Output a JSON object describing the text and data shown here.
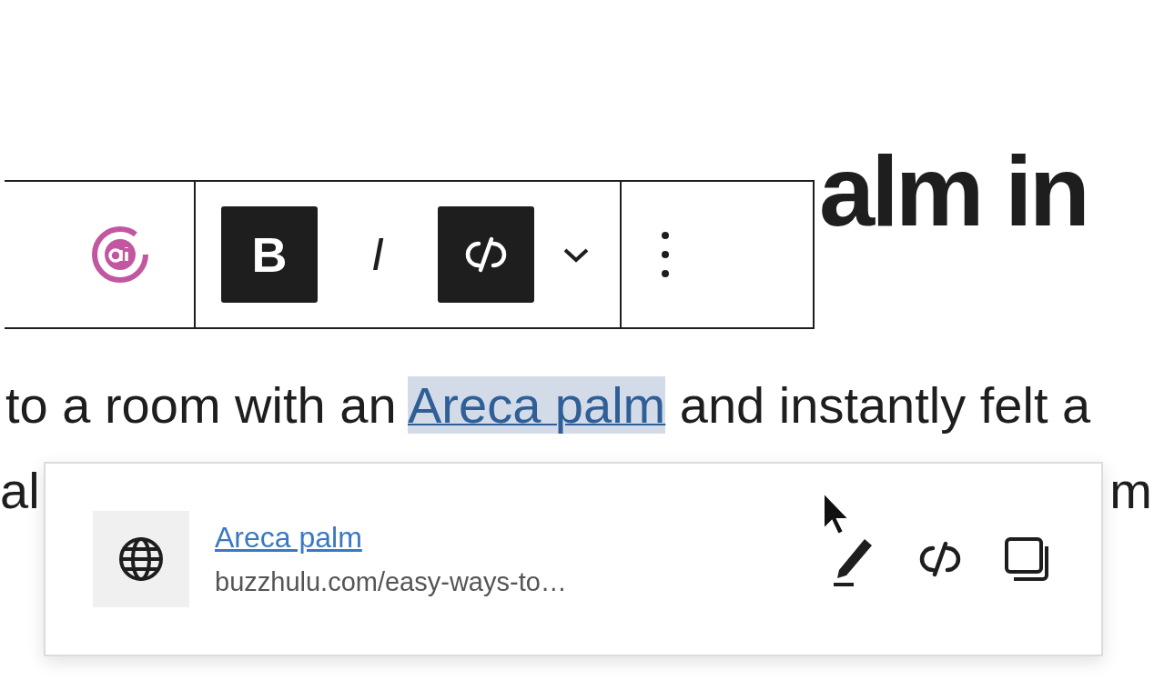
{
  "heading": "alm in",
  "toolbar": {
    "groups": [
      [
        {
          "kind": "ai",
          "selected": false
        }
      ],
      [
        {
          "kind": "bold",
          "label": "B",
          "selected": true
        },
        {
          "kind": "italic",
          "label": "I",
          "selected": false
        },
        {
          "kind": "link",
          "selected": true
        },
        {
          "kind": "more"
        }
      ],
      [
        {
          "kind": "options"
        }
      ]
    ]
  },
  "paragraph": {
    "before": "to a room with an ",
    "link": "Areca palm",
    "link_selected": true,
    "after": " and instantly felt a"
  },
  "second_line": [
    "al",
    "m"
  ],
  "link_popover": {
    "title": "Areca palm",
    "url": "buzzhulu.com/easy-ways-to…"
  }
}
